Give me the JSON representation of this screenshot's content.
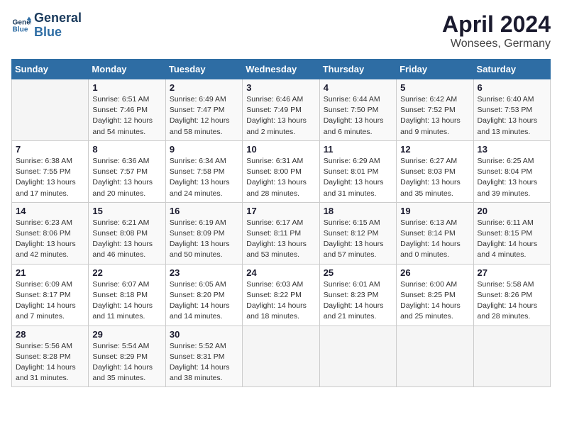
{
  "logo": {
    "line1": "General",
    "line2": "Blue"
  },
  "title": "April 2024",
  "subtitle": "Wonsees, Germany",
  "days_header": [
    "Sunday",
    "Monday",
    "Tuesday",
    "Wednesday",
    "Thursday",
    "Friday",
    "Saturday"
  ],
  "weeks": [
    [
      {
        "day": "",
        "info": ""
      },
      {
        "day": "1",
        "info": "Sunrise: 6:51 AM\nSunset: 7:46 PM\nDaylight: 12 hours\nand 54 minutes."
      },
      {
        "day": "2",
        "info": "Sunrise: 6:49 AM\nSunset: 7:47 PM\nDaylight: 12 hours\nand 58 minutes."
      },
      {
        "day": "3",
        "info": "Sunrise: 6:46 AM\nSunset: 7:49 PM\nDaylight: 13 hours\nand 2 minutes."
      },
      {
        "day": "4",
        "info": "Sunrise: 6:44 AM\nSunset: 7:50 PM\nDaylight: 13 hours\nand 6 minutes."
      },
      {
        "day": "5",
        "info": "Sunrise: 6:42 AM\nSunset: 7:52 PM\nDaylight: 13 hours\nand 9 minutes."
      },
      {
        "day": "6",
        "info": "Sunrise: 6:40 AM\nSunset: 7:53 PM\nDaylight: 13 hours\nand 13 minutes."
      }
    ],
    [
      {
        "day": "7",
        "info": "Sunrise: 6:38 AM\nSunset: 7:55 PM\nDaylight: 13 hours\nand 17 minutes."
      },
      {
        "day": "8",
        "info": "Sunrise: 6:36 AM\nSunset: 7:57 PM\nDaylight: 13 hours\nand 20 minutes."
      },
      {
        "day": "9",
        "info": "Sunrise: 6:34 AM\nSunset: 7:58 PM\nDaylight: 13 hours\nand 24 minutes."
      },
      {
        "day": "10",
        "info": "Sunrise: 6:31 AM\nSunset: 8:00 PM\nDaylight: 13 hours\nand 28 minutes."
      },
      {
        "day": "11",
        "info": "Sunrise: 6:29 AM\nSunset: 8:01 PM\nDaylight: 13 hours\nand 31 minutes."
      },
      {
        "day": "12",
        "info": "Sunrise: 6:27 AM\nSunset: 8:03 PM\nDaylight: 13 hours\nand 35 minutes."
      },
      {
        "day": "13",
        "info": "Sunrise: 6:25 AM\nSunset: 8:04 PM\nDaylight: 13 hours\nand 39 minutes."
      }
    ],
    [
      {
        "day": "14",
        "info": "Sunrise: 6:23 AM\nSunset: 8:06 PM\nDaylight: 13 hours\nand 42 minutes."
      },
      {
        "day": "15",
        "info": "Sunrise: 6:21 AM\nSunset: 8:08 PM\nDaylight: 13 hours\nand 46 minutes."
      },
      {
        "day": "16",
        "info": "Sunrise: 6:19 AM\nSunset: 8:09 PM\nDaylight: 13 hours\nand 50 minutes."
      },
      {
        "day": "17",
        "info": "Sunrise: 6:17 AM\nSunset: 8:11 PM\nDaylight: 13 hours\nand 53 minutes."
      },
      {
        "day": "18",
        "info": "Sunrise: 6:15 AM\nSunset: 8:12 PM\nDaylight: 13 hours\nand 57 minutes."
      },
      {
        "day": "19",
        "info": "Sunrise: 6:13 AM\nSunset: 8:14 PM\nDaylight: 14 hours\nand 0 minutes."
      },
      {
        "day": "20",
        "info": "Sunrise: 6:11 AM\nSunset: 8:15 PM\nDaylight: 14 hours\nand 4 minutes."
      }
    ],
    [
      {
        "day": "21",
        "info": "Sunrise: 6:09 AM\nSunset: 8:17 PM\nDaylight: 14 hours\nand 7 minutes."
      },
      {
        "day": "22",
        "info": "Sunrise: 6:07 AM\nSunset: 8:18 PM\nDaylight: 14 hours\nand 11 minutes."
      },
      {
        "day": "23",
        "info": "Sunrise: 6:05 AM\nSunset: 8:20 PM\nDaylight: 14 hours\nand 14 minutes."
      },
      {
        "day": "24",
        "info": "Sunrise: 6:03 AM\nSunset: 8:22 PM\nDaylight: 14 hours\nand 18 minutes."
      },
      {
        "day": "25",
        "info": "Sunrise: 6:01 AM\nSunset: 8:23 PM\nDaylight: 14 hours\nand 21 minutes."
      },
      {
        "day": "26",
        "info": "Sunrise: 6:00 AM\nSunset: 8:25 PM\nDaylight: 14 hours\nand 25 minutes."
      },
      {
        "day": "27",
        "info": "Sunrise: 5:58 AM\nSunset: 8:26 PM\nDaylight: 14 hours\nand 28 minutes."
      }
    ],
    [
      {
        "day": "28",
        "info": "Sunrise: 5:56 AM\nSunset: 8:28 PM\nDaylight: 14 hours\nand 31 minutes."
      },
      {
        "day": "29",
        "info": "Sunrise: 5:54 AM\nSunset: 8:29 PM\nDaylight: 14 hours\nand 35 minutes."
      },
      {
        "day": "30",
        "info": "Sunrise: 5:52 AM\nSunset: 8:31 PM\nDaylight: 14 hours\nand 38 minutes."
      },
      {
        "day": "",
        "info": ""
      },
      {
        "day": "",
        "info": ""
      },
      {
        "day": "",
        "info": ""
      },
      {
        "day": "",
        "info": ""
      }
    ]
  ]
}
